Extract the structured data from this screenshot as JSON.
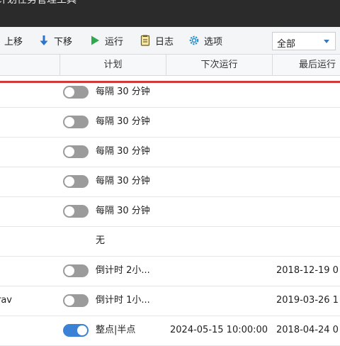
{
  "window": {
    "title": "计划任务管理工具"
  },
  "toolbar": {
    "buttons": [
      {
        "label": "上移"
      },
      {
        "label": "下移"
      },
      {
        "label": "运行"
      },
      {
        "label": "日志"
      },
      {
        "label": "选项"
      }
    ],
    "filter": {
      "selected": "全部"
    }
  },
  "table": {
    "columns": [
      "计划",
      "下次运行",
      "最后运行"
    ],
    "rows": [
      {
        "name": "",
        "enabled": false,
        "plan": "每隔 30 分钟",
        "next_run": "",
        "last_run": ""
      },
      {
        "name": "",
        "enabled": false,
        "plan": "每隔 30 分钟",
        "next_run": "",
        "last_run": ""
      },
      {
        "name": "",
        "enabled": false,
        "plan": "每隔 30 分钟",
        "next_run": "",
        "last_run": ""
      },
      {
        "name": "",
        "enabled": false,
        "plan": "每隔 30 分钟",
        "next_run": "",
        "last_run": ""
      },
      {
        "name": "",
        "enabled": false,
        "plan": "每隔 30 分钟",
        "next_run": "",
        "last_run": ""
      },
      {
        "name": "",
        "enabled": null,
        "plan": "无",
        "next_run": "",
        "last_run": ""
      },
      {
        "name": "",
        "enabled": false,
        "plan": "倒计时 2小...",
        "next_run": "",
        "last_run": "2018-12-19 0"
      },
      {
        "name": "rav",
        "enabled": false,
        "plan": "倒计时 1小...",
        "next_run": "",
        "last_run": "2019-03-26 1"
      },
      {
        "name": "",
        "enabled": true,
        "plan": "整点|半点",
        "next_run": "2024-05-15 10:00:00",
        "last_run": "2018-04-24 0"
      }
    ]
  },
  "colors": {
    "accent": "#3b82d6",
    "toggle_off": "#9b9b9b",
    "selection_line": "#cf3b3b",
    "titlebar": "#2b2b2b"
  }
}
